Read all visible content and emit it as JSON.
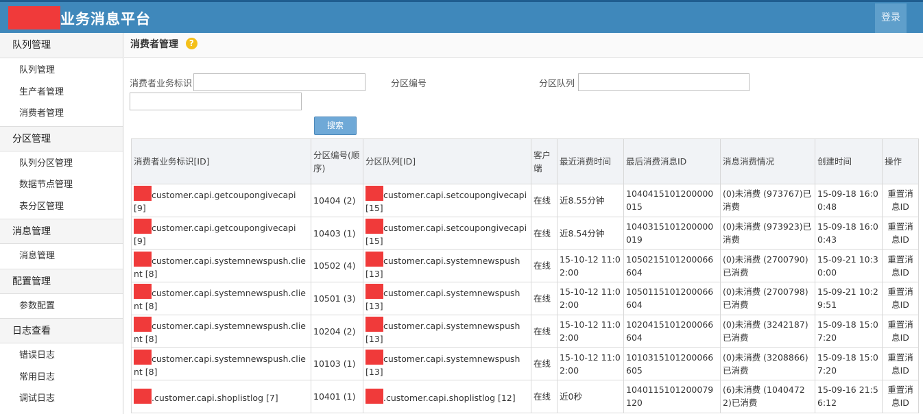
{
  "header": {
    "title": "业务消息平台",
    "login_label": "登录"
  },
  "sidebar": {
    "sections": [
      {
        "title": "队列管理",
        "items": [
          "队列管理",
          "生产者管理",
          "消费者管理"
        ]
      },
      {
        "title": "分区管理",
        "items": [
          "队列分区管理",
          "数据节点管理",
          "表分区管理"
        ]
      },
      {
        "title": "消息管理",
        "items": [
          "消息管理"
        ]
      },
      {
        "title": "配置管理",
        "items": [
          "参数配置"
        ]
      },
      {
        "title": "日志查看",
        "items": [
          "错误日志",
          "常用日志",
          "调试日志"
        ]
      }
    ]
  },
  "main": {
    "page_title": "消费者管理",
    "help_icon": "?",
    "filters": {
      "consumer_label": "消费者业务标识",
      "consumer_value": "",
      "partition_no_label": "分区编号",
      "partition_queue_label": "分区队列",
      "partition_queue_value": "",
      "extra_value": "",
      "search_label": "搜索"
    },
    "table": {
      "headers": [
        "消费者业务标识[ID]",
        "分区编号(顺序)",
        "分区队列[ID]",
        "客户端",
        "最近消费时间",
        "最后消费消息ID",
        "消息消费情况",
        "创建时间",
        "操作"
      ],
      "rows": [
        {
          "consumer": "customer.capi.getcoupongivecapi [9]",
          "partition": "10404 (2)",
          "queue": "customer.capi.setcoupongivecapi [15]",
          "client": "在线",
          "last_time": "近8.55分钟",
          "last_id": "1040415101200000015",
          "status": "(0)未消费 (973767)已消费",
          "created": "15-09-18 16:00:48",
          "op": "重置消息ID"
        },
        {
          "consumer": "customer.capi.getcoupongivecapi [9]",
          "partition": "10403 (1)",
          "queue": "customer.capi.setcoupongivecapi [15]",
          "client": "在线",
          "last_time": "近8.54分钟",
          "last_id": "1040315101200000019",
          "status": "(0)未消费 (973923)已消费",
          "created": "15-09-18 16:00:43",
          "op": "重置消息ID"
        },
        {
          "consumer": "customer.capi.systemnewspush.client [8]",
          "partition": "10502 (4)",
          "queue": "customer.capi.systemnewspush [13]",
          "client": "在线",
          "last_time": "15-10-12 11:02:00",
          "last_id": "1050215101200066604",
          "status": "(0)未消费 (2700790)已消费",
          "created": "15-09-21 10:30:00",
          "op": "重置消息ID"
        },
        {
          "consumer": "customer.capi.systemnewspush.client [8]",
          "partition": "10501 (3)",
          "queue": "customer.capi.systemnewspush [13]",
          "client": "在线",
          "last_time": "15-10-12 11:02:00",
          "last_id": "1050115101200066604",
          "status": "(0)未消费 (2700798)已消费",
          "created": "15-09-21 10:29:51",
          "op": "重置消息ID"
        },
        {
          "consumer": "customer.capi.systemnewspush.client [8]",
          "partition": "10204 (2)",
          "queue": "customer.capi.systemnewspush [13]",
          "client": "在线",
          "last_time": "15-10-12 11:02:00",
          "last_id": "1020415101200066604",
          "status": "(0)未消费 (3242187)已消费",
          "created": "15-09-18 15:07:20",
          "op": "重置消息ID"
        },
        {
          "consumer": "customer.capi.systemnewspush.client [8]",
          "partition": "10103 (1)",
          "queue": "customer.capi.systemnewspush [13]",
          "client": "在线",
          "last_time": "15-10-12 11:02:00",
          "last_id": "1010315101200066605",
          "status": "(0)未消费 (3208866)已消费",
          "created": "15-09-18 15:07:20",
          "op": "重置消息ID"
        },
        {
          "consumer": ".customer.capi.shoplistlog [7]",
          "partition": "10401 (1)",
          "queue": ".customer.capi.shoplistlog [12]",
          "client": "在线",
          "last_time": "近0秒",
          "last_id": "1040115101200079120",
          "status": "(6)未消费 (10404722)已消费",
          "created": "15-09-16 21:56:12",
          "op": "重置消息ID"
        }
      ]
    }
  },
  "colors": {
    "header_bg": "#3f88bb",
    "online": "#1a8a1a",
    "redaction": "#f03a3a",
    "button": "#6fa9d7"
  }
}
